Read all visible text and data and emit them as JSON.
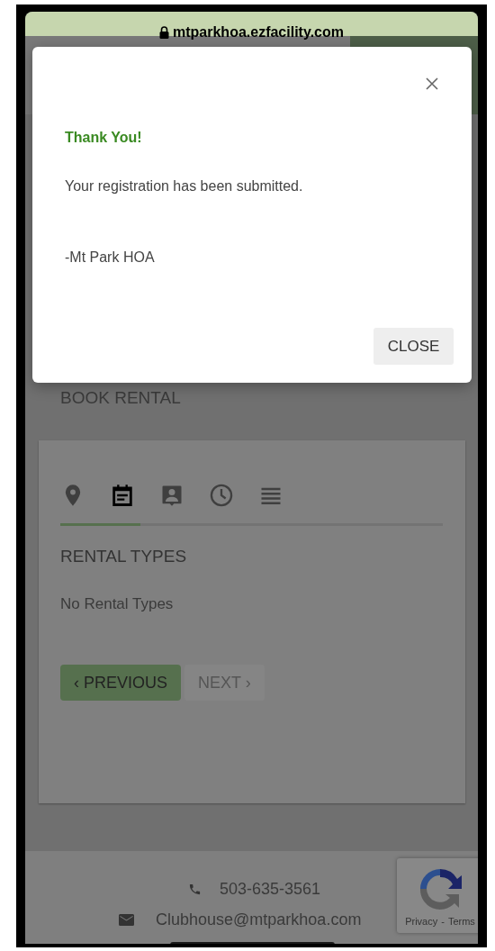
{
  "browser": {
    "url": "mtparkhoa.ezfacility.com"
  },
  "modal": {
    "title": "Thank You!",
    "message": "Your registration has been submitted.",
    "signature": "-Mt Park HOA",
    "close_button": "CLOSE"
  },
  "page": {
    "heading": "BOOK RENTAL",
    "steps": [
      {
        "kind": "location",
        "selected": false
      },
      {
        "kind": "calendar",
        "selected": true
      },
      {
        "kind": "contact",
        "selected": false
      },
      {
        "kind": "clock",
        "selected": false
      },
      {
        "kind": "list",
        "selected": false
      }
    ],
    "progress": {
      "level": 0.21
    },
    "section_title": "RENTAL TYPES",
    "empty_text": "No Rental Types",
    "buttons": [
      {
        "label": "‹ PREVIOUS",
        "kind": "primary"
      },
      {
        "label": "NEXT ›",
        "kind": "secondary"
      }
    ]
  },
  "footer": {
    "phone": "503-635-3561",
    "email": "Clubhouse@mtparkhoa.com"
  },
  "recaptcha": {
    "links": [
      "Privacy",
      "Terms"
    ],
    "separator": "-"
  }
}
